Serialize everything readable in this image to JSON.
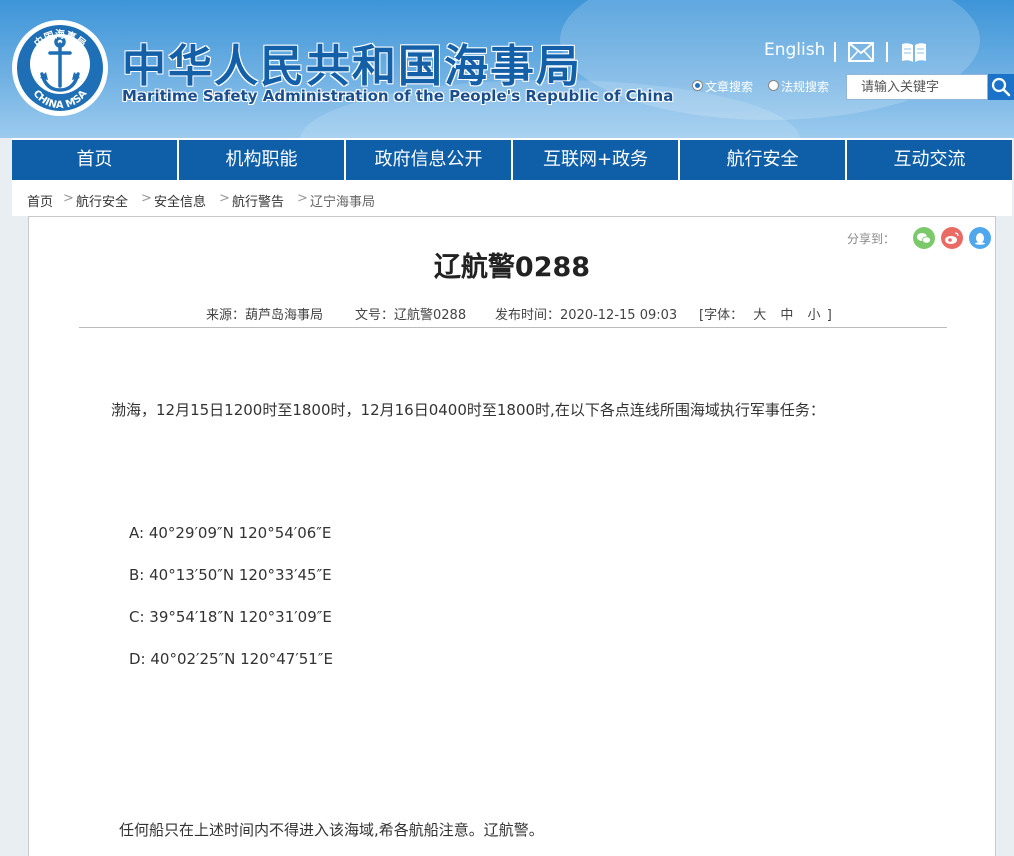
{
  "header": {
    "title": "中华人民共和国海事局",
    "subtitle": "Maritime Safety Administration of the People's Republic of China",
    "logo_text_top": "中国海事局",
    "logo_text_bottom": "CHINA MSA",
    "english_link": "English",
    "mail_icon": "mail-icon",
    "book_icon": "book-icon",
    "search": {
      "options": [
        "文章搜索",
        "法规搜索"
      ],
      "selected": "文章搜索",
      "placeholder": "请输入关键字",
      "button_icon": "search-icon"
    },
    "colors": {
      "brand_blue": "#1460a8",
      "nav_blue": "#0e5ea8",
      "accent": "#1a73c9"
    }
  },
  "nav": {
    "items": [
      "首页",
      "机构职能",
      "政府信息公开",
      "互联网+政务",
      "航行安全",
      "互动交流"
    ]
  },
  "breadcrumb": [
    "首页",
    "航行安全",
    "安全信息",
    "航行警告",
    "辽宁海事局"
  ],
  "share": {
    "label": "分享到：",
    "icons": [
      "wechat-icon",
      "weibo-icon",
      "qq-icon"
    ]
  },
  "article": {
    "title": "辽航警0288",
    "source_label": "来源：",
    "source": "葫芦岛海事局",
    "doc_label": "文号：",
    "doc_no": "辽航警0288",
    "time_label": "发布时间：",
    "time": "2020-12-15 09:03",
    "font_label": "[字体：",
    "font_sizes": [
      "大",
      "中",
      "小"
    ],
    "font_close": "]",
    "intro": "渤海，12月15日1200时至1800时，12月16日0400时至1800时,在以下各点连线所围海域执行军事任务：",
    "points": [
      "A: 40°29′09″N 120°54′06″E",
      "B: 40°13′50″N 120°33′45″E",
      "C: 39°54′18″N 120°31′09″E",
      "D: 40°02′25″N 120°47′51″E"
    ],
    "closing": "任何船只在上述时间内不得进入该海域,希各航船注意。辽航警。"
  }
}
